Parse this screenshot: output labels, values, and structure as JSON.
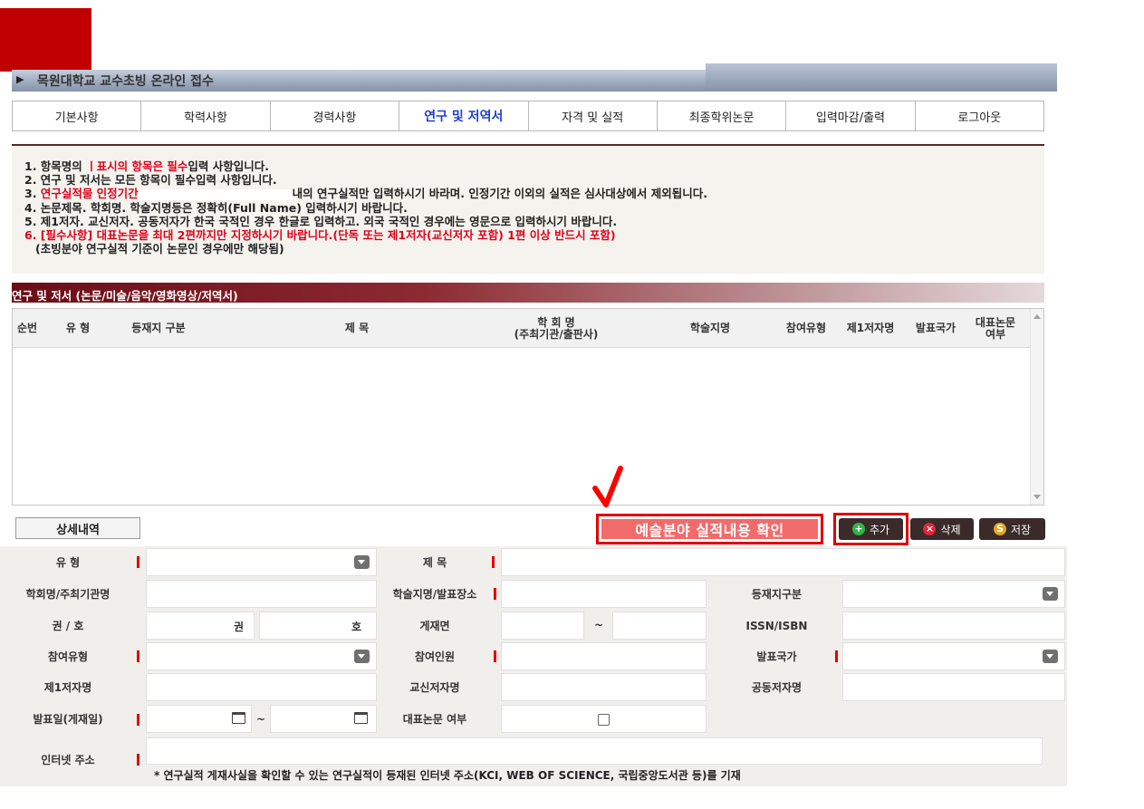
{
  "app": {
    "title": "목원대학교 교수초빙 온라인 접수"
  },
  "tabs": [
    {
      "label": "기본사항",
      "active": false
    },
    {
      "label": "학력사항",
      "active": false
    },
    {
      "label": "경력사항",
      "active": false
    },
    {
      "label": "연구 및 저역서",
      "active": true
    },
    {
      "label": "자격 및 실적",
      "active": false
    },
    {
      "label": "최종학위논문",
      "active": false
    },
    {
      "label": "입력마감/출력",
      "active": false
    },
    {
      "label": "로그아웃",
      "active": false
    }
  ],
  "notice": {
    "line1_a": "1. 항목명의 ",
    "line1_red": "ㅣ표시의 항목은 필수",
    "line1_b": "입력 사항입니다.",
    "line2": "2. 연구 및 저서는 모든 항목이 필수입력 사항입니다.",
    "line3_num": "3. ",
    "line3_red": "연구실적물 인정기간",
    "line3_b": "내의 연구실적만 입력하시기 바라며. 인정기간 이외의 실적은 심사대상에서 제외됩니다.",
    "line4": "4. 논문제목. 학회명. 학술지명등은 정확히(Full Name) 입력하시기 바랍니다.",
    "line5": "5. 제1저자. 교신저자. 공동저자가 한국 국적인 경우 한글로 입력하고. 외국 국적인 경우에는 영문으로 입력하시기 바랍니다.",
    "line6_red": "6. [필수사항] 대표논문을 최대 2편까지만 지정하시기 바랍니다.(단독 또는 제1저자(교신저자 포함) 1편 이상 반드시 포함)",
    "line7": "(초빙분야 연구실적 기준이 논문인 경우에만 해당됨)"
  },
  "section": {
    "title": "연구 및 저서 (논문/미술/음악/영화영상/저역서)"
  },
  "grid": {
    "columns": [
      "순번",
      "유 형",
      "등재지 구분",
      "제 목",
      "학 회 명",
      "(주최기관/출판사)",
      "학술지명",
      "참여유형",
      "제1저자명",
      "발표국가",
      "대표논문",
      "여부"
    ]
  },
  "detail": {
    "tab_label": "상세내역",
    "art_button": "예술분야 실적내용 확인",
    "add_button": "추가",
    "delete_button": "삭제",
    "save_button": "저장"
  },
  "form": {
    "type_label": "유 형",
    "title_label": "제 목",
    "society_label": "학회명/주최기관명",
    "journal_label": "학술지명/발표장소",
    "listing_label": "등재지구분",
    "volume_label": "권 / 호",
    "volume_unit": "권",
    "issue_unit": "호",
    "pages_label": "게재면",
    "pages_sep": "~",
    "issn_label": "ISSN/ISBN",
    "participation_label": "참여유형",
    "participants_label": "참여인원",
    "country_label": "발표국가",
    "first_author_label": "제1저자명",
    "corresponding_label": "교신저자명",
    "coauthor_label": "공동저자명",
    "pubdate_label": "발표일(게재일)",
    "date_sep": "~",
    "representative_label": "대표논문 여부",
    "url_label": "인터넷 주소",
    "url_note": "* 연구실적 게재사실을 확인할 수 있는 연구실적이 등재된 인터넷 주소(KCI, WEB OF SCIENCE, 국립중앙도서관 등)를 기재"
  },
  "colors": {
    "brand_red": "#c00000",
    "active_tab": "#1f3fd0",
    "required": "#e00000",
    "section_bar": "#6b0d16"
  }
}
